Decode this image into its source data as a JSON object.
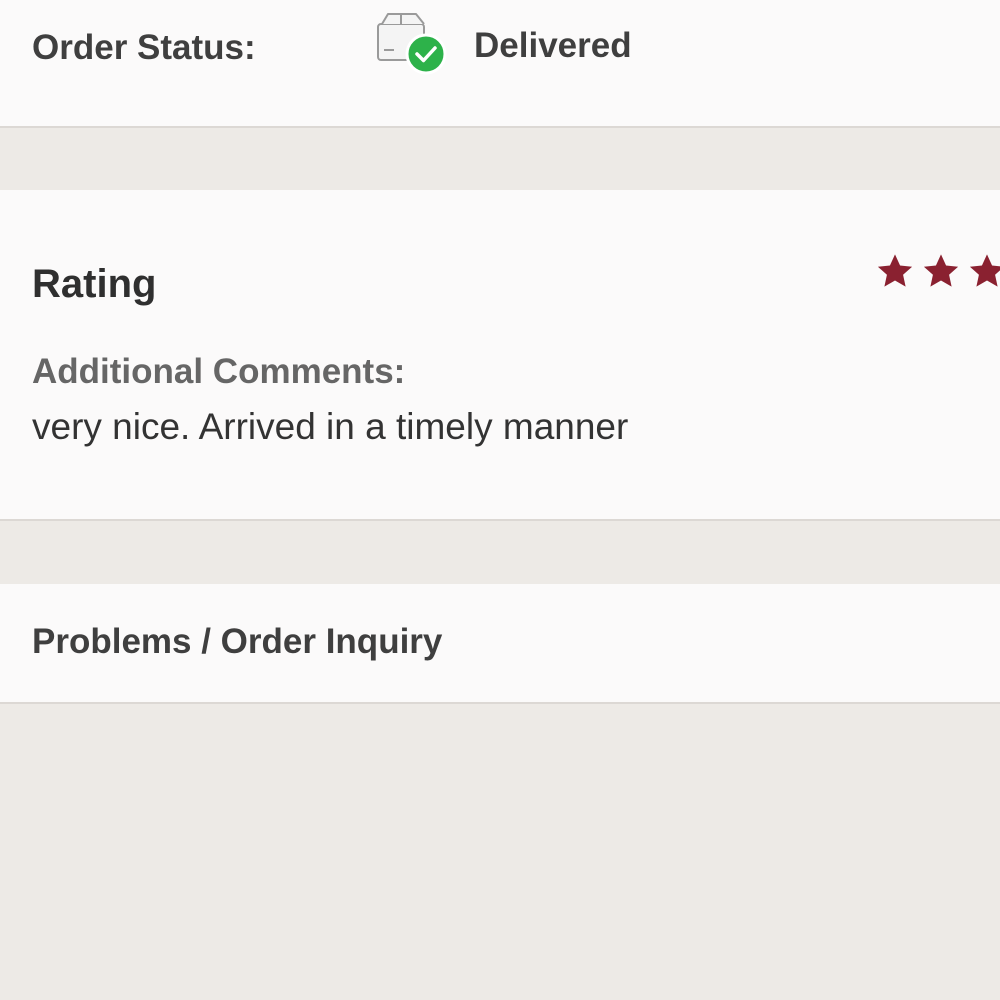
{
  "order_status": {
    "label": "Order Status:",
    "value": "Delivered",
    "icon": "package-delivered-icon",
    "check_color": "#2db24a"
  },
  "rating": {
    "title": "Rating",
    "stars_visible": 3,
    "star_color": "#8a2130",
    "comments_label": "Additional Comments:",
    "comments_text": "very nice. Arrived in a timely manner"
  },
  "inquiry": {
    "label": "Problems / Order Inquiry"
  }
}
